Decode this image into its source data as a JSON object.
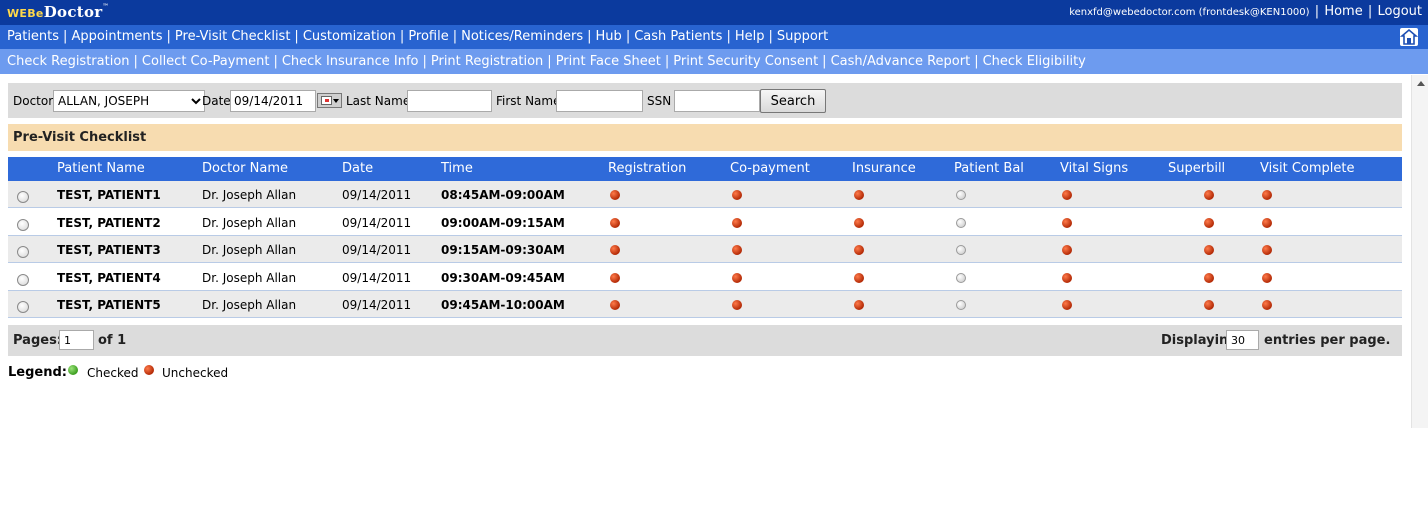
{
  "header": {
    "logo_prefix": "WEBe",
    "logo_main": "Doctor",
    "logo_tm": "™",
    "user_email": "kenxfd@webedoctor.com",
    "user_account": "(frontdesk@KEN1000)",
    "separator": "|",
    "home_label": "Home",
    "logout_label": "Logout"
  },
  "main_nav": {
    "items": [
      {
        "label": "Patients"
      },
      {
        "label": "Appointments"
      },
      {
        "label": "Pre-Visit Checklist"
      },
      {
        "label": "Customization"
      },
      {
        "label": "Profile"
      },
      {
        "label": "Notices/Reminders"
      },
      {
        "label": "Hub"
      },
      {
        "label": "Cash Patients"
      },
      {
        "label": "Help"
      },
      {
        "label": "Support"
      }
    ],
    "separator": "|",
    "icon": "home-lock-icon"
  },
  "sub_nav": {
    "items": [
      {
        "label": "Check Registration"
      },
      {
        "label": "Collect Co-Payment"
      },
      {
        "label": "Check Insurance Info"
      },
      {
        "label": "Print Registration"
      },
      {
        "label": "Print Face Sheet"
      },
      {
        "label": "Print Security Consent"
      },
      {
        "label": "Cash/Advance Report"
      },
      {
        "label": "Check Eligibility"
      }
    ],
    "separator": "|"
  },
  "search": {
    "doctor_label": "Doctor",
    "doctor_value": "ALLAN, JOSEPH",
    "date_label": "Date",
    "date_value": "09/14/2011",
    "last_name_label": "Last Name",
    "last_name_value": "",
    "first_name_label": "First Name",
    "first_name_value": "",
    "ssn_label": "SSN",
    "ssn_value": "",
    "search_button": "Search"
  },
  "section_title": "Pre-Visit Checklist",
  "table": {
    "columns": {
      "patient_name": "Patient Name",
      "doctor_name": "Doctor Name",
      "date": "Date",
      "time": "Time",
      "registration": "Registration",
      "copayment": "Co-payment",
      "insurance": "Insurance",
      "patient_bal": "Patient Bal",
      "vital_signs": "Vital Signs",
      "superbill": "Superbill",
      "visit_complete": "Visit Complete"
    },
    "rows": [
      {
        "patient": "TEST, PATIENT1",
        "doctor": "Dr. Joseph Allan",
        "date": "09/14/2011",
        "time": "08:45AM-09:00AM",
        "status": [
          "unchecked",
          "unchecked",
          "unchecked",
          "empty",
          "unchecked",
          "unchecked",
          "unchecked"
        ]
      },
      {
        "patient": "TEST, PATIENT2",
        "doctor": "Dr. Joseph Allan",
        "date": "09/14/2011",
        "time": "09:00AM-09:15AM",
        "status": [
          "unchecked",
          "unchecked",
          "unchecked",
          "empty",
          "unchecked",
          "unchecked",
          "unchecked"
        ]
      },
      {
        "patient": "TEST, PATIENT3",
        "doctor": "Dr. Joseph Allan",
        "date": "09/14/2011",
        "time": "09:15AM-09:30AM",
        "status": [
          "unchecked",
          "unchecked",
          "unchecked",
          "empty",
          "unchecked",
          "unchecked",
          "unchecked"
        ]
      },
      {
        "patient": "TEST, PATIENT4",
        "doctor": "Dr. Joseph Allan",
        "date": "09/14/2011",
        "time": "09:30AM-09:45AM",
        "status": [
          "unchecked",
          "unchecked",
          "unchecked",
          "empty",
          "unchecked",
          "unchecked",
          "unchecked"
        ]
      },
      {
        "patient": "TEST, PATIENT5",
        "doctor": "Dr. Joseph Allan",
        "date": "09/14/2011",
        "time": "09:45AM-10:00AM",
        "status": [
          "unchecked",
          "unchecked",
          "unchecked",
          "empty",
          "unchecked",
          "unchecked",
          "unchecked"
        ]
      }
    ]
  },
  "pager": {
    "pages_label": "Pages:",
    "page_value": "1",
    "of_label": "of 1",
    "displaying_label": "Displaying",
    "per_page_value": "30",
    "per_page_suffix": "entries per page."
  },
  "legend": {
    "title": "Legend:",
    "checked_label": "Checked",
    "unchecked_label": "Unchecked"
  },
  "colors": {
    "top_bar": "#0b3a9e",
    "main_nav": "#2863d0",
    "sub_nav": "#6d9bef",
    "table_header": "#2f6ad9",
    "section_title_bg": "#f7dcb0",
    "status_unchecked": "#c0390f",
    "status_checked": "#4caf2a"
  }
}
